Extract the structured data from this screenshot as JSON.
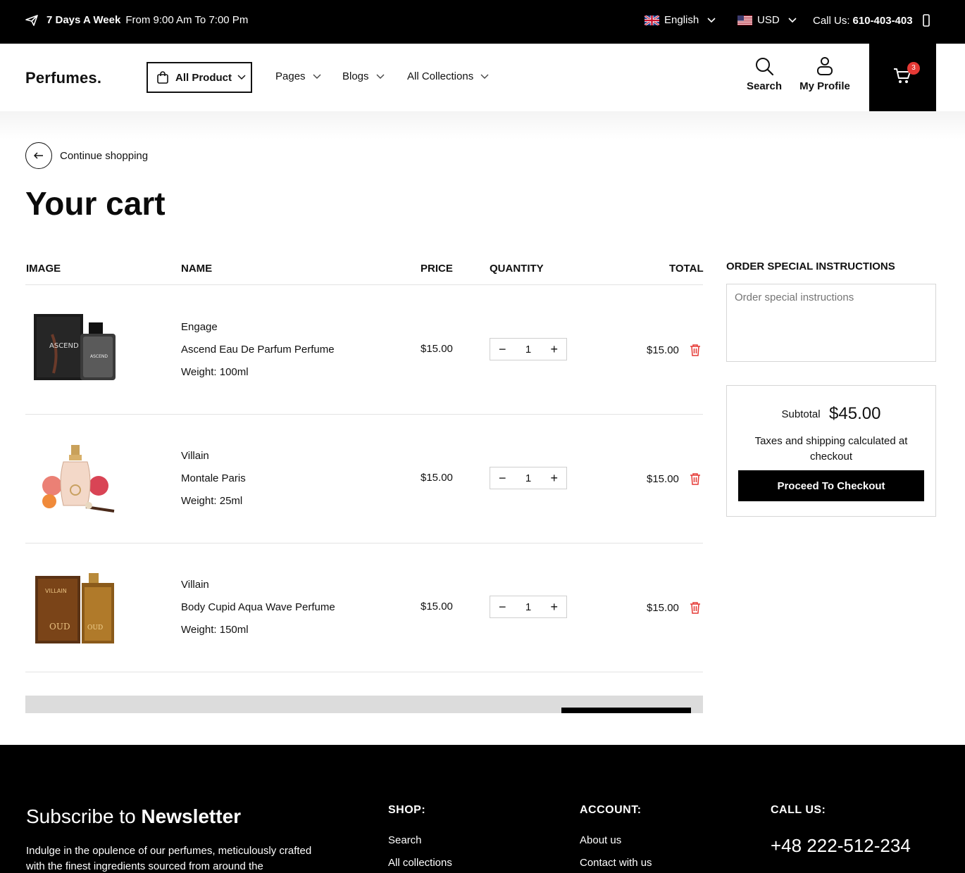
{
  "topbar": {
    "hours_bold": "7 Days A Week",
    "hours_rest": "From 9:00 Am To 7:00 Pm",
    "language": "English",
    "currency": "USD",
    "call_label": "Call Us:",
    "call_number": "610-403-403"
  },
  "header": {
    "logo": "Perfumes.",
    "all_product": "All Product",
    "nav": [
      "Pages",
      "Blogs",
      "All Collections"
    ],
    "search_label": "Search",
    "profile_label": "My Profile",
    "cart_count": "3"
  },
  "continue_label": "Continue shopping",
  "page_title": "Your cart",
  "table": {
    "headers": {
      "image": "IMAGE",
      "name": "NAME",
      "price": "PRICE",
      "quantity": "QUANTITY",
      "total": "TOTAL"
    },
    "rows": [
      {
        "vendor": "Engage",
        "title": "Ascend Eau De Parfum Perfume",
        "variant": "Weight: 100ml",
        "price": "$15.00",
        "qty": "1",
        "total": "$15.00",
        "image": "ascend-bottle"
      },
      {
        "vendor": "Villain",
        "title": "Montale Paris",
        "variant": "Weight: 25ml",
        "price": "$15.00",
        "qty": "1",
        "total": "$15.00",
        "image": "montale-bottle"
      },
      {
        "vendor": "Villain",
        "title": "Body Cupid Aqua Wave Perfume",
        "variant": "Weight: 150ml",
        "price": "$15.00",
        "qty": "1",
        "total": "$15.00",
        "image": "oud-bottle"
      }
    ]
  },
  "instructions": {
    "title": "ORDER SPECIAL INSTRUCTIONS",
    "placeholder": "Order special instructions"
  },
  "summary": {
    "subtotal_label": "Subtotal",
    "subtotal_value": "$45.00",
    "taxes_note": "Taxes and shipping calculated at checkout",
    "checkout_label": "Proceed To Checkout"
  },
  "footer": {
    "newsletter_title_a": "Subscribe to",
    "newsletter_title_b": "Newsletter",
    "newsletter_text": "Indulge in the opulence of our perfumes, meticulously crafted with the finest ingredients sourced from around the",
    "shop_title": "SHOP:",
    "shop_links": [
      "Search",
      "All collections"
    ],
    "account_title": "ACCOUNT:",
    "account_links": [
      "About us",
      "Contact with us"
    ],
    "call_title": "CALL US:",
    "phone": "+48 222-512-234"
  },
  "colors": {
    "accent": "#000000",
    "badge": "#e53935",
    "trash": "#e53935"
  }
}
